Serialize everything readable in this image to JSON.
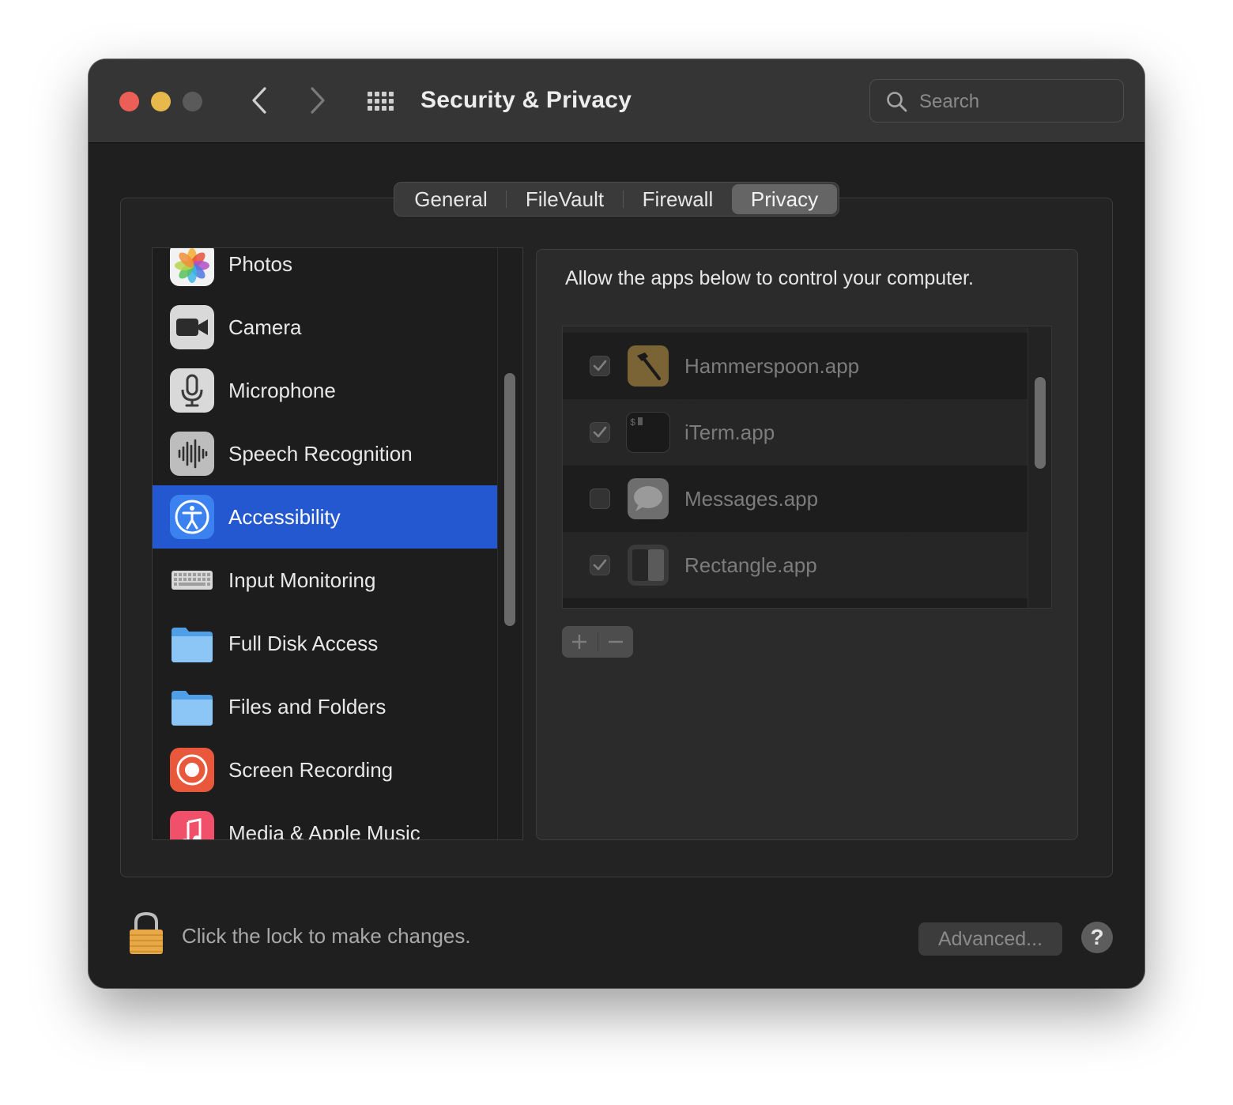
{
  "window": {
    "title": "Security & Privacy",
    "search_placeholder": "Search"
  },
  "tabs": [
    {
      "label": "General",
      "selected": false
    },
    {
      "label": "FileVault",
      "selected": false
    },
    {
      "label": "Firewall",
      "selected": false
    },
    {
      "label": "Privacy",
      "selected": true
    }
  ],
  "sidebar": {
    "items": [
      {
        "label": "Photos",
        "icon": "photos-icon"
      },
      {
        "label": "Camera",
        "icon": "camera-icon"
      },
      {
        "label": "Microphone",
        "icon": "microphone-icon"
      },
      {
        "label": "Speech Recognition",
        "icon": "speech-recognition-icon"
      },
      {
        "label": "Accessibility",
        "icon": "accessibility-icon",
        "selected": true
      },
      {
        "label": "Input Monitoring",
        "icon": "keyboard-icon"
      },
      {
        "label": "Full Disk Access",
        "icon": "folder-icon"
      },
      {
        "label": "Files and Folders",
        "icon": "folder-icon"
      },
      {
        "label": "Screen Recording",
        "icon": "screen-recording-icon"
      },
      {
        "label": "Media & Apple Music",
        "icon": "music-icon"
      }
    ]
  },
  "panel": {
    "description": "Allow the apps below to control your computer.",
    "apps": [
      {
        "name": "Hammerspoon.app",
        "checked": true,
        "icon": "hammer-icon"
      },
      {
        "name": "iTerm.app",
        "checked": true,
        "icon": "terminal-icon"
      },
      {
        "name": "Messages.app",
        "checked": false,
        "icon": "messages-icon"
      },
      {
        "name": "Rectangle.app",
        "checked": true,
        "icon": "rectangle-icon"
      }
    ],
    "add_symbol": "+",
    "remove_symbol": "−"
  },
  "footer": {
    "lock_text": "Click the lock to make changes.",
    "advanced_label": "Advanced...",
    "help_label": "?"
  },
  "colors": {
    "selection": "#2458d0",
    "close": "#ec5f57",
    "minimize": "#e7b84b",
    "zoom_disabled": "#5a5a5a",
    "lock": "#e8a845"
  }
}
